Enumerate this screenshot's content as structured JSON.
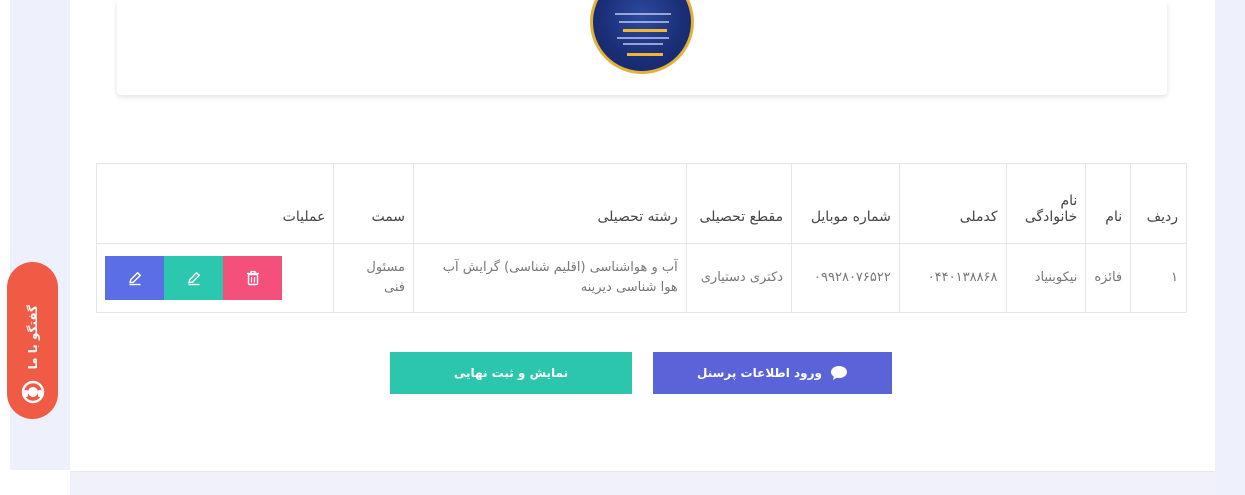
{
  "table": {
    "headers": {
      "row": "ردیف",
      "name": "نام",
      "family": "نام خانوادگی",
      "national_code": "کدملی",
      "mobile": "شماره موبایل",
      "degree": "مقطع تحصیلی",
      "field": "رشته تحصیلی",
      "position": "سمت",
      "operations": "عملیات"
    },
    "rows": [
      {
        "row": "۱",
        "name": "فائزه",
        "family": "نیکوبنیاد",
        "national_code": "۰۴۴۰۱۳۸۸۶۸",
        "mobile": "۰۹۹۲۸۰۷۶۵۲۲",
        "degree": "دکتری دستیاری",
        "field": "آب و هواشناسی (اقلیم شناسی) گرایش آب هوا شناسی دیرینه",
        "position": "مسئول فنی"
      }
    ]
  },
  "buttons": {
    "personnel": "ورود اطلاعات پرسنل",
    "show_submit": "نمایش و ثبت نهایی"
  },
  "floating": {
    "label": "گفتگو با ما"
  },
  "colors": {
    "primary": "#5a63d8",
    "teal": "#2cc6ad",
    "danger": "#f4507c",
    "floating": "#ef5b45"
  },
  "icons": {
    "edit": "pencil-icon",
    "delete": "trash-icon",
    "chat": "chat-bubble-icon",
    "support": "support-icon"
  }
}
